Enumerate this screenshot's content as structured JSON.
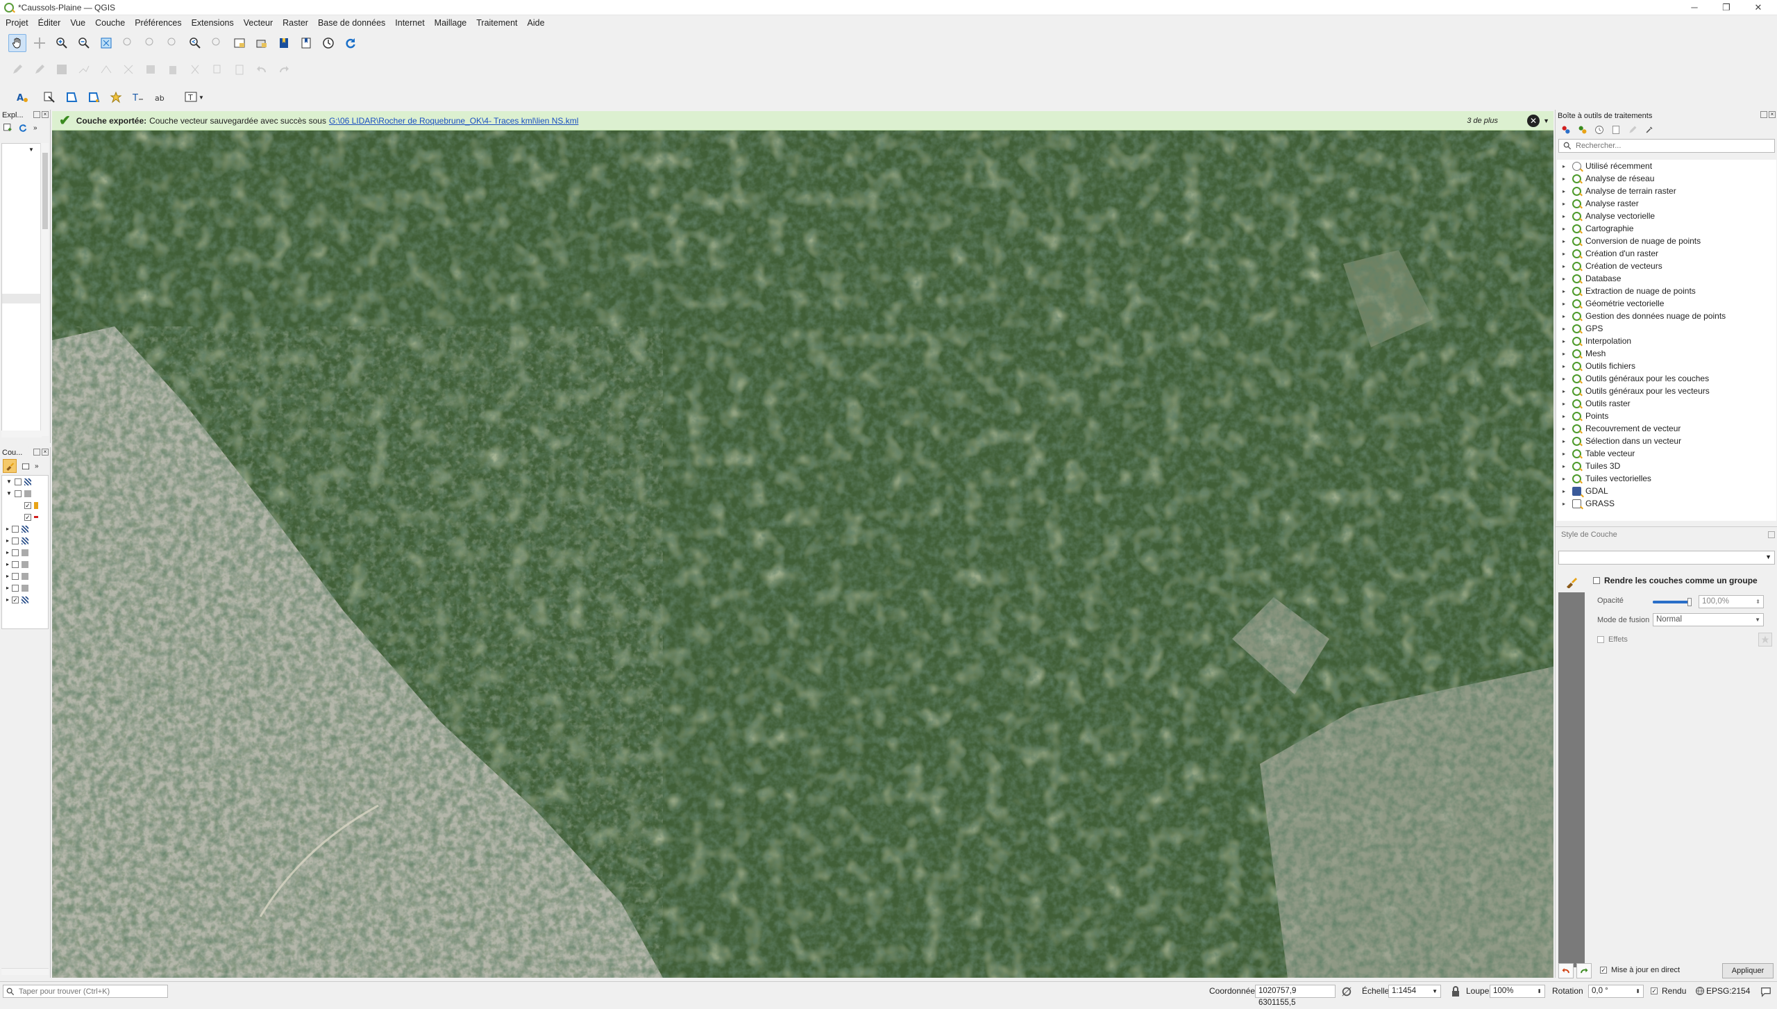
{
  "window": {
    "title": "*Caussols-Plaine — QGIS"
  },
  "menu": [
    "Projet",
    "Éditer",
    "Vue",
    "Couche",
    "Préférences",
    "Extensions",
    "Vecteur",
    "Raster",
    "Base de données",
    "Internet",
    "Maillage",
    "Traitement",
    "Aide"
  ],
  "left_panels": {
    "browser_title": "Expl...",
    "layers_title": "Cou..."
  },
  "message": {
    "bold": "Couche exportée:",
    "text": "Couche vecteur sauvegardée avec succès sous",
    "link": "G:\\06 LIDAR\\Rocher de Roquebrune_OK\\4- Traces kml\\lien NS.kml",
    "more": "3 de plus"
  },
  "processing": {
    "title": "Boîte à outils de traitements",
    "search_placeholder": "Rechercher...",
    "items": [
      "Utilisé récemment",
      "Analyse de réseau",
      "Analyse de terrain raster",
      "Analyse raster",
      "Analyse vectorielle",
      "Cartographie",
      "Conversion de nuage de points",
      "Création d'un raster",
      "Création de vecteurs",
      "Database",
      "Extraction de nuage de points",
      "Géométrie vectorielle",
      "Gestion des données nuage de points",
      "GPS",
      "Interpolation",
      "Mesh",
      "Outils fichiers",
      "Outils généraux pour les couches",
      "Outils généraux pour les vecteurs",
      "Outils raster",
      "Points",
      "Recouvrement de vecteur",
      "Sélection dans un vecteur",
      "Table vecteur",
      "Tuiles 3D",
      "Tuiles vectorielles",
      "GDAL",
      "GRASS"
    ]
  },
  "style_panel": {
    "title": "Style de Couche",
    "render_group": "Rendre les couches comme un groupe",
    "opacity_label": "Opacité",
    "opacity_value": "100,0%",
    "opacity_level": 1.0,
    "blend_label": "Mode de fusion",
    "blend_value": "Normal",
    "effects_label": "Effets",
    "live_update": "Mise à jour en direct",
    "apply": "Appliquer"
  },
  "status": {
    "locator_placeholder": "Taper pour trouver (Ctrl+K)",
    "coord_label": "Coordonnée",
    "coord_value": "1020757,9  6301155,5",
    "scale_label": "Échelle",
    "scale_value": "1:1454",
    "magnifier_label": "Loupe",
    "magnifier_value": "100%",
    "rotation_label": "Rotation",
    "rotation_value": "0,0 °",
    "render_label": "Rendu",
    "crs": "EPSG:2154"
  },
  "colors": {
    "accent": "#4c9a2a",
    "message_bg": "#dcf0d0",
    "forest": "#3e5d35",
    "rock": "#b7b9ae"
  }
}
